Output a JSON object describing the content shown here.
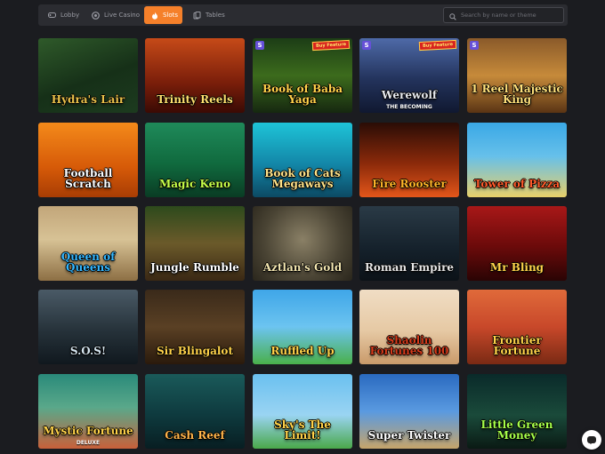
{
  "nav": {
    "tabs": [
      {
        "label": "Lobby",
        "icon": "gamepad-icon",
        "active": false
      },
      {
        "label": "Live Casino",
        "icon": "chip-icon",
        "active": false
      },
      {
        "label": "Slots",
        "icon": "flame-icon",
        "active": true
      },
      {
        "label": "Tables",
        "icon": "cards-icon",
        "active": false
      }
    ],
    "search": {
      "placeholder": "Search by name or theme"
    }
  },
  "colors": {
    "accent": "#f5802a",
    "background": "#1b1c20",
    "nav_bg": "#2b2c31"
  },
  "games": [
    {
      "title": "Hydra's Lair",
      "bg": "linear-gradient(160deg,#2f5a2a,#163018 55%,#1d3b1f)",
      "color": "#e9c14a"
    },
    {
      "title": "Trinity Reels",
      "bg": "linear-gradient(180deg,#c64a18,#7a1e0a 60%,#3a0a04)",
      "color": "#ffdf6e"
    },
    {
      "title": "Book of Baba Yaga",
      "bg": "linear-gradient(180deg,#1c3d16,#3c6b1c 50%,#162810)",
      "color": "#ffd24a",
      "badge": "Buy Feature",
      "s_badge": "S"
    },
    {
      "title": "Werewolf",
      "sub": "THE BECOMING",
      "bg": "linear-gradient(180deg,#4e6aa8,#23335c 55%,#101830)",
      "color": "#e6e9ef",
      "badge": "Buy Feature",
      "s_badge": "S"
    },
    {
      "title": "1 Reel Majestic King",
      "bg": "linear-gradient(180deg,#8a5a2a,#c68a3a 50%,#5a3414)",
      "color": "#ffe07a",
      "s_badge": "S"
    },
    {
      "title": "Football Scratch",
      "bg": "linear-gradient(180deg,#f48a1a,#d65a08 60%,#a83d04)",
      "color": "#ffffff"
    },
    {
      "title": "Magic Keno",
      "bg": "linear-gradient(180deg,#1f8a5a,#106a3e 55%,#0a3c24)",
      "color": "#c6ff4a"
    },
    {
      "title": "Book of Cats Megaways",
      "bg": "linear-gradient(180deg,#1ec4d8,#1387a8 55%,#0c4a64)",
      "color": "#ffe38a"
    },
    {
      "title": "Fire Rooster",
      "bg": "linear-gradient(180deg,#2a0c06,#8c2a0a 55%,#e3561a)",
      "color": "#ffb428"
    },
    {
      "title": "Tower of Pizza",
      "bg": "linear-gradient(180deg,#3aa8e6,#66c0ea 45%,#e8d06a)",
      "color": "#ff5a2a"
    },
    {
      "title": "Queen of Queens",
      "bg": "linear-gradient(180deg,#c2a67a,#d7c295 45%,#8d6f44)",
      "color": "#34b7ff"
    },
    {
      "title": "Jungle Rumble",
      "bg": "linear-gradient(180deg,#2d4a1c,#6b5a2a 50%,#3a2814)",
      "color": "#ffffff"
    },
    {
      "title": "Aztlan's Gold",
      "bg": "radial-gradient(circle at 50% 45%,#8a8066,#4a4434 60%,#2a261c)",
      "color": "#f3e6b0"
    },
    {
      "title": "Roman Empire",
      "bg": "linear-gradient(180deg,#2a3a46,#14202a 60%,#0c1218)",
      "color": "#e6e6e6"
    },
    {
      "title": "Mr Bling",
      "bg": "linear-gradient(180deg,#a81818,#6a0a0a 55%,#2a0404)",
      "color": "#ffd24a"
    },
    {
      "title": "S.O.S!",
      "bg": "linear-gradient(180deg,#4a5a66,#26323a 55%,#10181e)",
      "color": "#d6e6f0"
    },
    {
      "title": "Sir Blingalot",
      "bg": "linear-gradient(180deg,#3a2a1a,#5a4024 50%,#2a1a0c)",
      "color": "#ffd24a"
    },
    {
      "title": "Ruffled Up",
      "bg": "linear-gradient(180deg,#3fa6e8,#6cc4f0 50%,#4ab04a)",
      "color": "#ffd24a"
    },
    {
      "title": "Shaolin Fortunes 100",
      "bg": "linear-gradient(180deg,#f0ddc4,#e6c9a4 55%,#c99a6a)",
      "color": "#d63a1a"
    },
    {
      "title": "Frontier Fortune",
      "bg": "linear-gradient(180deg,#e06a3a,#c8482a 50%,#7a2a14)",
      "color": "#ffd24a"
    },
    {
      "title": "Mystic Fortune",
      "sub": "DELUXE",
      "bg": "linear-gradient(180deg,#2a8a7a,#5aa88a 45%,#c8603a)",
      "color": "#ffd24a"
    },
    {
      "title": "Cash Reef",
      "bg": "linear-gradient(180deg,#1a5a5a,#0e3a3e 55%,#081e22)",
      "color": "#ffb44a"
    },
    {
      "title": "Sky's The Limit!",
      "bg": "linear-gradient(180deg,#6ac0f0,#9ad4f2 55%,#4aa84a)",
      "color": "#ffd24a"
    },
    {
      "title": "Super Twister",
      "bg": "linear-gradient(180deg,#2a6ac0,#5a9ae0 50%,#c6a46a)",
      "color": "#ffffff"
    },
    {
      "title": "Little Green Money",
      "bg": "linear-gradient(180deg,#0a2a2a,#1a4a3a 55%,#0a1a14)",
      "color": "#a6ff4a"
    }
  ]
}
